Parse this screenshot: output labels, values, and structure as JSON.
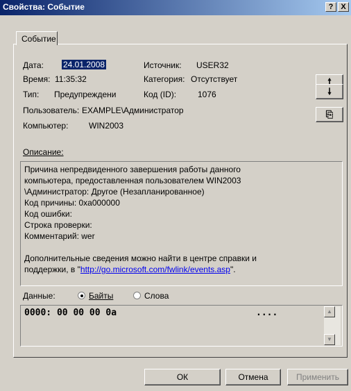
{
  "window": {
    "title": "Свойства: Событие",
    "help_glyph": "?",
    "close_glyph": "X"
  },
  "tab": {
    "label": "Событие"
  },
  "fields": {
    "date_label": "Дата:",
    "date_value": "24.01.2008",
    "source_label": "Источник:",
    "source_value": "USER32",
    "time_label": "Время:",
    "time_value": "11:35:32",
    "category_label": "Категория:",
    "category_value": "Отсутствует",
    "type_label": "Тип:",
    "type_value": "Предупреждени",
    "id_label": "Код (ID):",
    "id_value": "1076",
    "user_label": "Пользователь:",
    "user_value": "EXAMPLE\\Администратор",
    "computer_label": "Компьютер:",
    "computer_value": "WIN2003"
  },
  "nav": {
    "up_glyph": "🠕",
    "down_glyph": "🠗",
    "copy_glyph": "⎘"
  },
  "description": {
    "label": "Описание:",
    "lines": [
      "Причина непредвиденного завершения работы данного",
      "компьютера, предоставленная пользователем WIN2003",
      "\\Администратор: Другое (Незапланированное)",
      " Код причины: 0xa000000",
      " Код ошибки:",
      " Строка проверки:",
      " Комментарий: wer",
      "",
      "Дополнительные сведения можно найти в центре справки и"
    ],
    "last_line_prefix": "поддержки, в \"",
    "link_text": "http://go.microsoft.com/fwlink/events.asp",
    "last_line_suffix": "\"."
  },
  "data": {
    "label": "Данные:",
    "bytes_label": "Байты",
    "words_label": "Слова",
    "hex_row": "0000: 00 00 00 0a",
    "ascii_row": "...."
  },
  "buttons": {
    "ok": "ОК",
    "cancel": "Отмена",
    "apply": "Применить"
  }
}
